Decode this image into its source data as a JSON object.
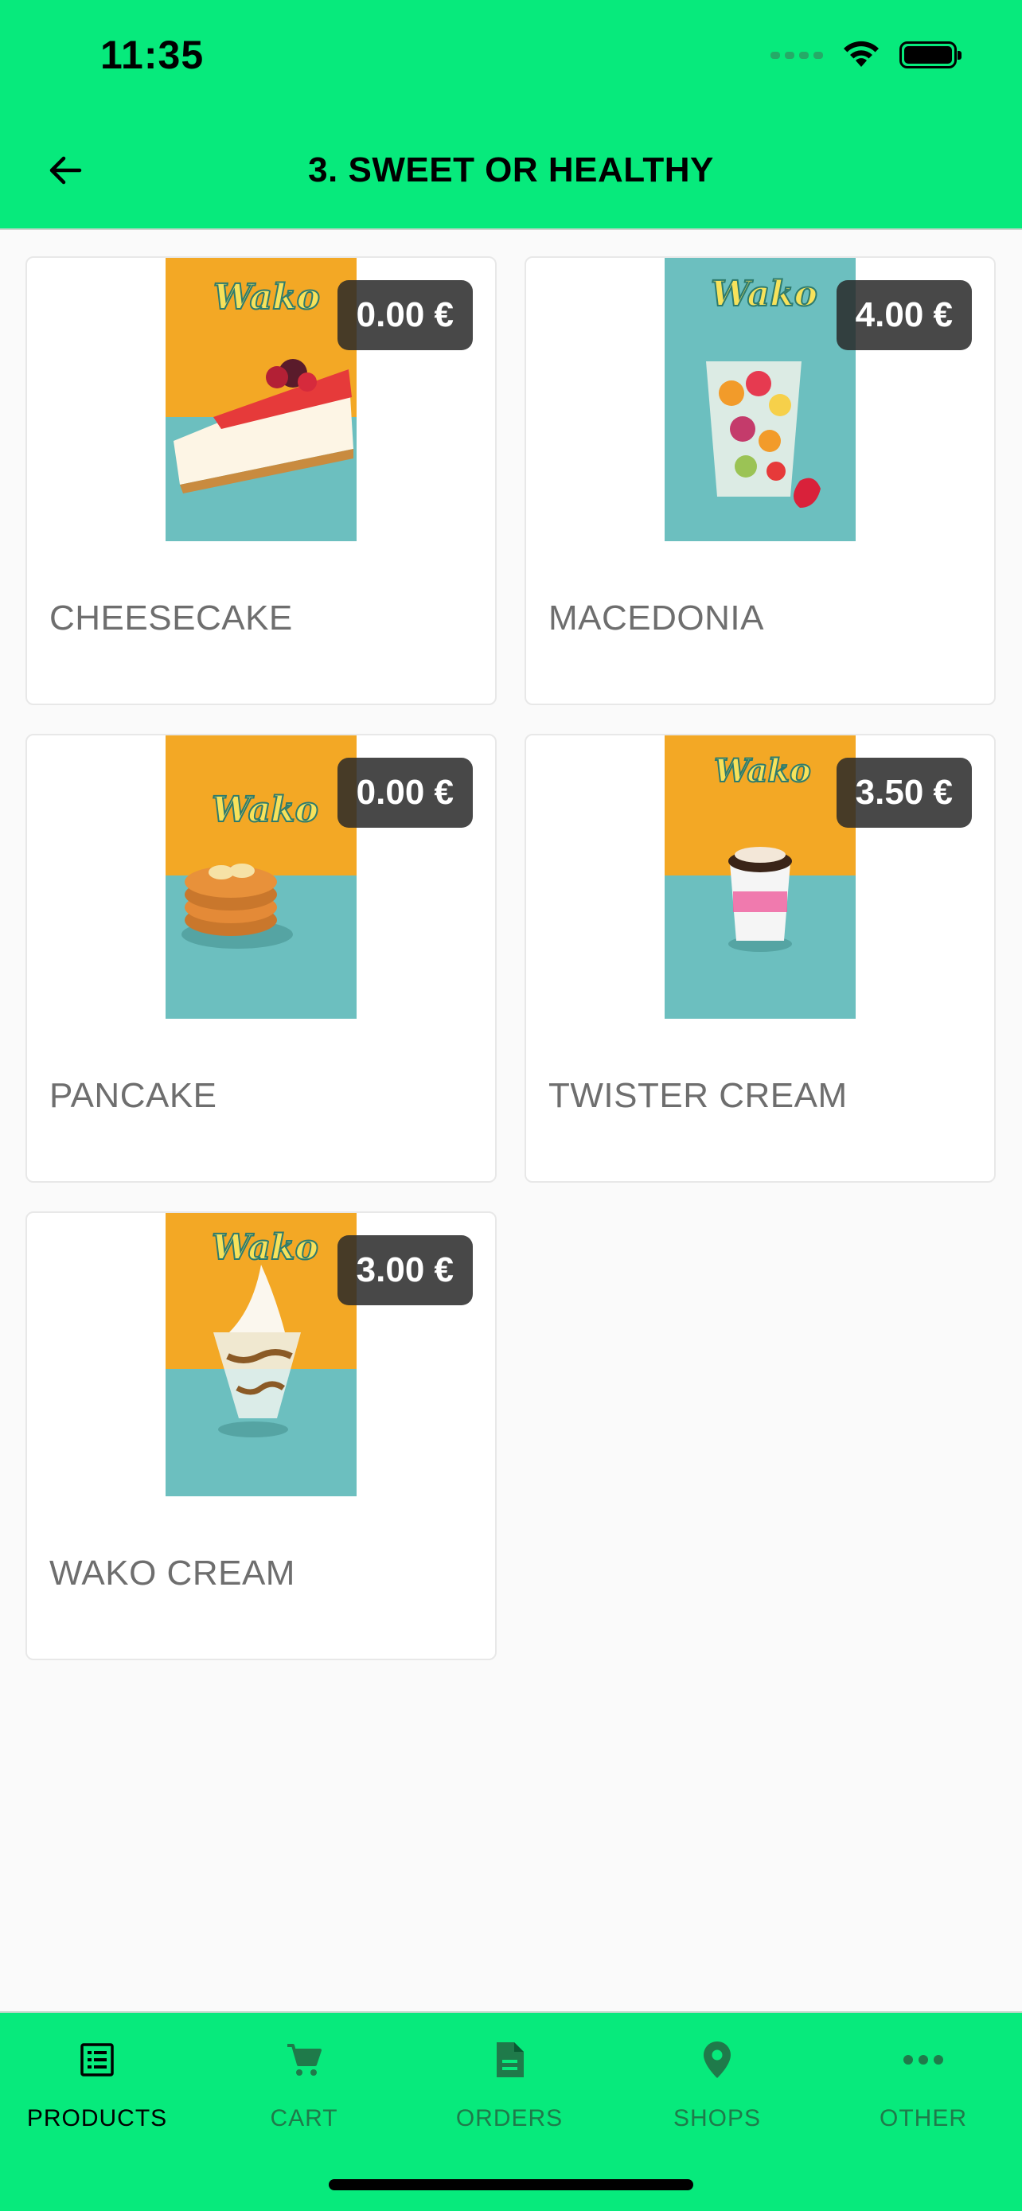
{
  "status_bar": {
    "time": "11:35"
  },
  "header": {
    "title": "3. SWEET OR HEALTHY"
  },
  "products": [
    {
      "name": "CHEESECAKE",
      "price": "0.00 €"
    },
    {
      "name": "MACEDONIA",
      "price": "4.00 €"
    },
    {
      "name": "PANCAKE",
      "price": "0.00 €"
    },
    {
      "name": "TWISTER CREAM",
      "price": "3.50 €"
    },
    {
      "name": "WAKO CREAM",
      "price": "3.00 €"
    }
  ],
  "image_brand": "Wako",
  "bottom_nav": [
    {
      "label": "PRODUCTS",
      "icon": "list-icon",
      "active": true
    },
    {
      "label": "CART",
      "icon": "cart-icon",
      "active": false
    },
    {
      "label": "ORDERS",
      "icon": "document-icon",
      "active": false
    },
    {
      "label": "SHOPS",
      "icon": "location-pin-icon",
      "active": false
    },
    {
      "label": "OTHER",
      "icon": "more-horizontal-icon",
      "active": false
    }
  ],
  "colors": {
    "brand": "#07ea7c",
    "nav_inactive": "#1f7a4a",
    "price_badge": "#2f2f2f",
    "image_orange": "#f3a825",
    "image_teal": "#6cbfbf"
  }
}
